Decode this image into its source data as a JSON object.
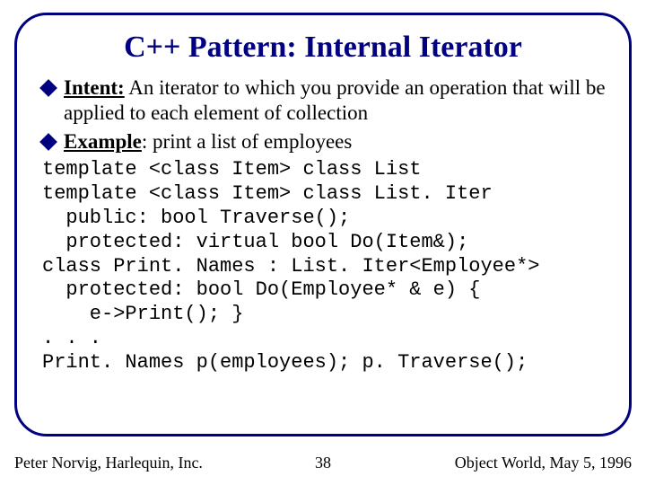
{
  "slide": {
    "title": "C++ Pattern: Internal Iterator",
    "bullets": [
      {
        "label": "Intent:",
        "text": " An iterator to which you provide an operation that will be applied to each element of collection"
      },
      {
        "label": "Example",
        "text": ": print a list of employees"
      }
    ],
    "code": "template <class Item> class List\ntemplate <class Item> class List. Iter\n  public: bool Traverse();\n  protected: virtual bool Do(Item&);\nclass Print. Names : List. Iter<Employee*>\n  protected: bool Do(Employee* & e) {\n    e->Print(); }\n. . .\nPrint. Names p(employees); p. Traverse();"
  },
  "footer": {
    "left": "Peter Norvig, Harlequin, Inc.",
    "center": "38",
    "right": "Object World, May 5, 1996"
  }
}
